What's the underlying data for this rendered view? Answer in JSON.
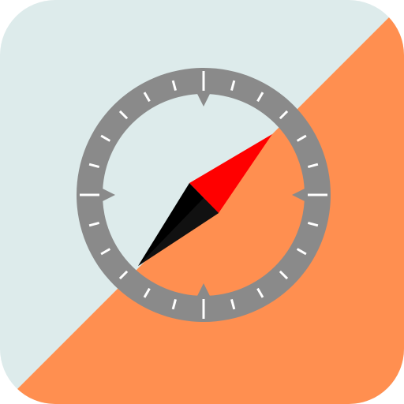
{
  "icon": {
    "name": "compass-app-icon",
    "colors": {
      "background_light": "#DDEBEB",
      "background_orange": "#FF8F50",
      "bezel": "#8A8A8A",
      "tick": "#FFFFFF",
      "needle_north": "#FF0000",
      "needle_south": "#000000",
      "needle_shade": "#111111"
    }
  }
}
